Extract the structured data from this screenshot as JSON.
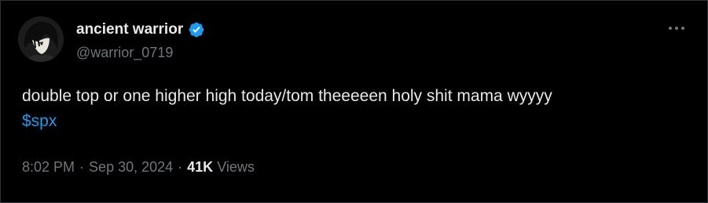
{
  "tweet": {
    "author": {
      "display_name": "ancient warrior",
      "handle": "@warrior_0719",
      "verified_icon": "verified-badge-icon",
      "avatar_icon": "avatar-image"
    },
    "more_icon": "more-options-icon",
    "text_line1": "double top or one higher high today/tom theeeeen holy shit mama wyyyy",
    "cashtag": "$spx",
    "time": "8:02 PM",
    "separator1": "·",
    "date": "Sep 30, 2024",
    "separator2": "·",
    "views_count": "41K",
    "views_label": "Views"
  },
  "colors": {
    "background": "#000000",
    "text_primary": "#e7e9ea",
    "text_secondary": "#71767b",
    "link": "#1d9bf0",
    "verified": "#1d9bf0",
    "border": "#2f3336"
  }
}
